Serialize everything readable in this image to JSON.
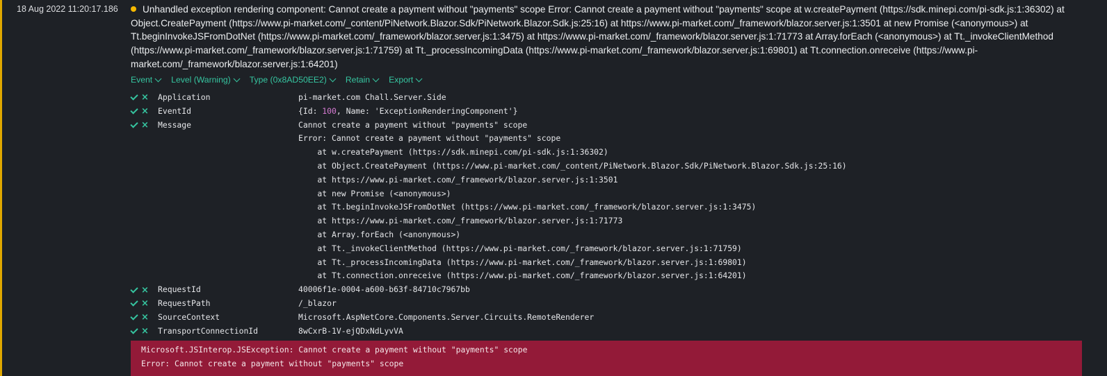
{
  "event": {
    "timestamp": "18 Aug 2022  11:20:17.186",
    "level_color": "#f5b800",
    "message": "Unhandled exception rendering component: Cannot create a payment without \"payments\" scope Error: Cannot create a payment without \"payments\" scope at w.createPayment (https://sdk.minepi.com/pi-sdk.js:1:36302) at Object.CreatePayment (https://www.pi-market.com/_content/PiNetwork.Blazor.Sdk/PiNetwork.Blazor.Sdk.js:25:16) at https://www.pi-market.com/_framework/blazor.server.js:1:3501 at new Promise (<anonymous>) at Tt.beginInvokeJSFromDotNet (https://www.pi-market.com/_framework/blazor.server.js:1:3475) at https://www.pi-market.com/_framework/blazor.server.js:1:71773 at Array.forEach (<anonymous>) at Tt._invokeClientMethod (https://www.pi-market.com/_framework/blazor.server.js:1:71759) at Tt._processIncomingData (https://www.pi-market.com/_framework/blazor.server.js:1:69801) at Tt.connection.onreceive (https://www.pi-market.com/_framework/blazor.server.js:1:64201)"
  },
  "toolbar": {
    "event": "Event",
    "level": "Level (Warning)",
    "type": "Type (0x8AD50EE2)",
    "retain": "Retain",
    "export": "Export"
  },
  "properties": {
    "application": {
      "name": "Application",
      "value": "pi-market.com Chall.Server.Side"
    },
    "eventid": {
      "name": "EventId",
      "open": "{Id: ",
      "id": "100",
      "mid": ", Name: ",
      "label": "'ExceptionRenderingComponent'",
      "close": "}"
    },
    "message": {
      "name": "Message",
      "lines": [
        "Cannot create a payment without \"payments\" scope",
        "Error: Cannot create a payment without \"payments\" scope",
        "    at w.createPayment (https://sdk.minepi.com/pi-sdk.js:1:36302)",
        "    at Object.CreatePayment (https://www.pi-market.com/_content/PiNetwork.Blazor.Sdk/PiNetwork.Blazor.Sdk.js:25:16)",
        "    at https://www.pi-market.com/_framework/blazor.server.js:1:3501",
        "    at new Promise (<anonymous>)",
        "    at Tt.beginInvokeJSFromDotNet (https://www.pi-market.com/_framework/blazor.server.js:1:3475)",
        "    at https://www.pi-market.com/_framework/blazor.server.js:1:71773",
        "    at Array.forEach (<anonymous>)",
        "    at Tt._invokeClientMethod (https://www.pi-market.com/_framework/blazor.server.js:1:71759)",
        "    at Tt._processIncomingData (https://www.pi-market.com/_framework/blazor.server.js:1:69801)",
        "    at Tt.connection.onreceive (https://www.pi-market.com/_framework/blazor.server.js:1:64201)"
      ]
    },
    "requestid": {
      "name": "RequestId",
      "value": "40006f1e-0004-a600-b63f-84710c7967bb"
    },
    "requestpath": {
      "name": "RequestPath",
      "value": "/_blazor"
    },
    "sourcecontext": {
      "name": "SourceContext",
      "value": "Microsoft.AspNetCore.Components.Server.Circuits.RemoteRenderer"
    },
    "transport": {
      "name": "TransportConnectionId",
      "value": "8wCxrB-1V-ejQDxNdLyvVA"
    }
  },
  "exception": {
    "line1": "Microsoft.JSInterop.JSException: Cannot create a payment without \"payments\" scope",
    "line2": "Error: Cannot create a payment without \"payments\" scope"
  },
  "colors": {
    "accent": "#36c5a0",
    "warning_bar": "#e0a800",
    "exception_bg": "#931a38",
    "background": "#1e2126",
    "number": "#d77bd3"
  }
}
